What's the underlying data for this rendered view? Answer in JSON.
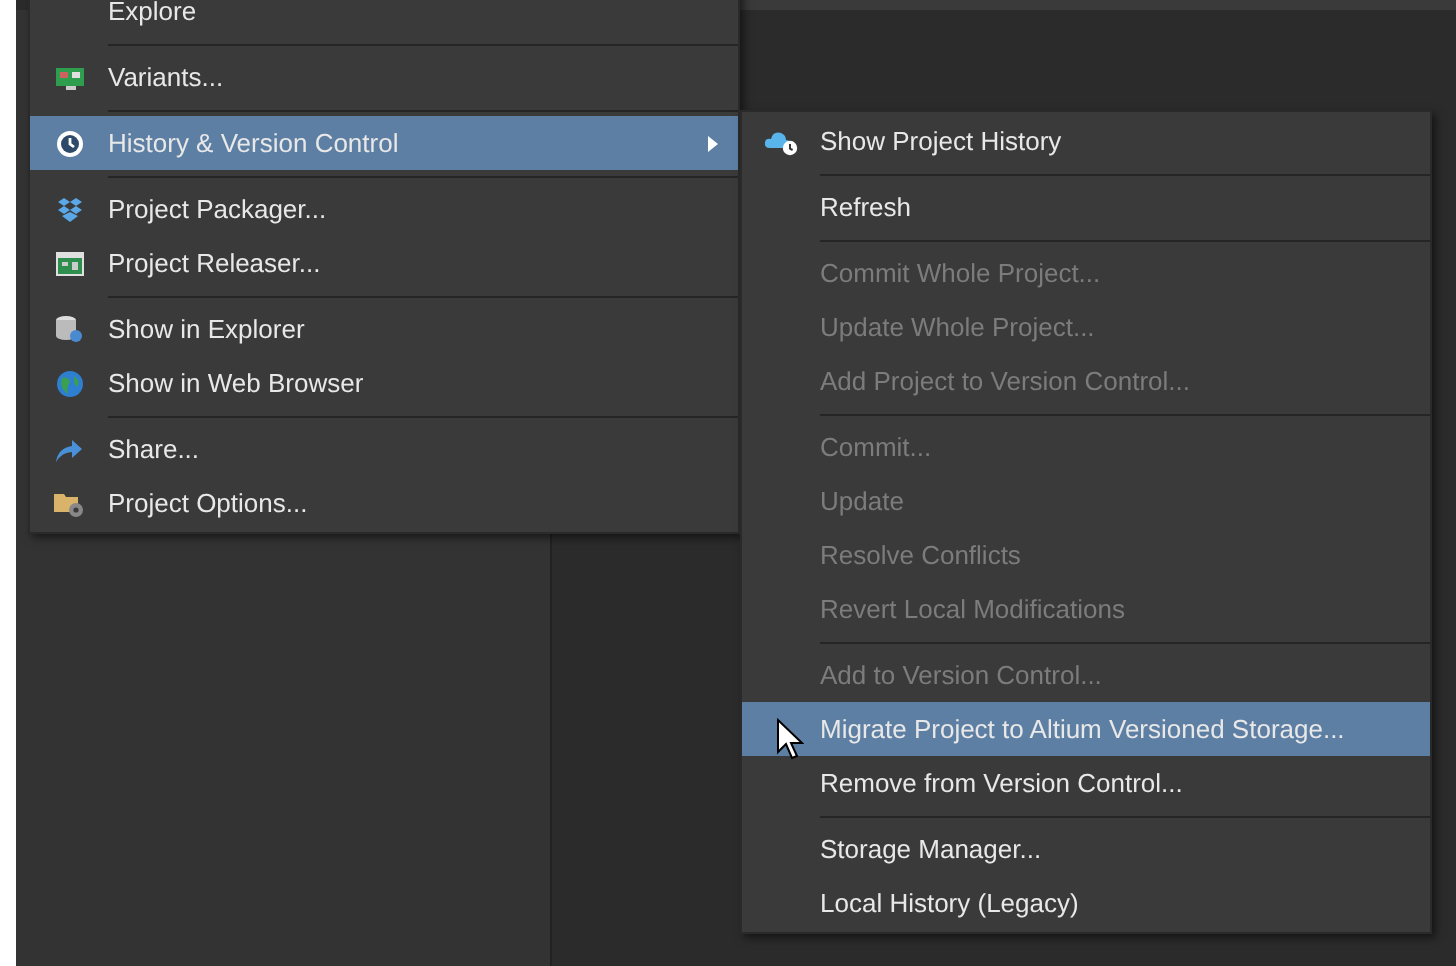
{
  "main_menu": {
    "items": [
      {
        "kind": "item",
        "label": "Explore",
        "selected": false,
        "submenu": false,
        "disabled": false
      },
      {
        "kind": "separator"
      },
      {
        "kind": "item",
        "label": "Variants...",
        "selected": false,
        "submenu": false,
        "disabled": false
      },
      {
        "kind": "separator"
      },
      {
        "kind": "item",
        "label": "History & Version Control",
        "selected": true,
        "submenu": true,
        "disabled": false
      },
      {
        "kind": "separator"
      },
      {
        "kind": "item",
        "label": "Project Packager...",
        "selected": false,
        "submenu": false,
        "disabled": false
      },
      {
        "kind": "item",
        "label": "Project Releaser...",
        "selected": false,
        "submenu": false,
        "disabled": false
      },
      {
        "kind": "separator"
      },
      {
        "kind": "item",
        "label": "Show in Explorer",
        "selected": false,
        "submenu": false,
        "disabled": false
      },
      {
        "kind": "item",
        "label": "Show in Web Browser",
        "selected": false,
        "submenu": false,
        "disabled": false
      },
      {
        "kind": "separator"
      },
      {
        "kind": "item",
        "label": "Share...",
        "selected": false,
        "submenu": false,
        "disabled": false
      },
      {
        "kind": "item",
        "label": "Project Options...",
        "selected": false,
        "submenu": false,
        "disabled": false
      }
    ]
  },
  "submenu": {
    "items": [
      {
        "kind": "item",
        "label": "Show Project History",
        "selected": false,
        "disabled": false
      },
      {
        "kind": "separator"
      },
      {
        "kind": "item",
        "label": "Refresh",
        "selected": false,
        "disabled": false
      },
      {
        "kind": "separator"
      },
      {
        "kind": "item",
        "label": "Commit Whole Project...",
        "selected": false,
        "disabled": true
      },
      {
        "kind": "item",
        "label": "Update Whole Project...",
        "selected": false,
        "disabled": true
      },
      {
        "kind": "item",
        "label": "Add Project to Version Control...",
        "selected": false,
        "disabled": true
      },
      {
        "kind": "separator"
      },
      {
        "kind": "item",
        "label": "Commit...",
        "selected": false,
        "disabled": true
      },
      {
        "kind": "item",
        "label": "Update",
        "selected": false,
        "disabled": true
      },
      {
        "kind": "item",
        "label": "Resolve Conflicts",
        "selected": false,
        "disabled": true
      },
      {
        "kind": "item",
        "label": "Revert Local Modifications",
        "selected": false,
        "disabled": true
      },
      {
        "kind": "separator"
      },
      {
        "kind": "item",
        "label": "Add to Version Control...",
        "selected": false,
        "disabled": true
      },
      {
        "kind": "item",
        "label": "Migrate Project to Altium Versioned Storage...",
        "selected": true,
        "disabled": false
      },
      {
        "kind": "item",
        "label": "Remove from Version Control...",
        "selected": false,
        "disabled": false
      },
      {
        "kind": "separator"
      },
      {
        "kind": "item",
        "label": "Storage Manager...",
        "selected": false,
        "disabled": false
      },
      {
        "kind": "item",
        "label": "Local History (Legacy)",
        "selected": false,
        "disabled": false
      }
    ]
  }
}
